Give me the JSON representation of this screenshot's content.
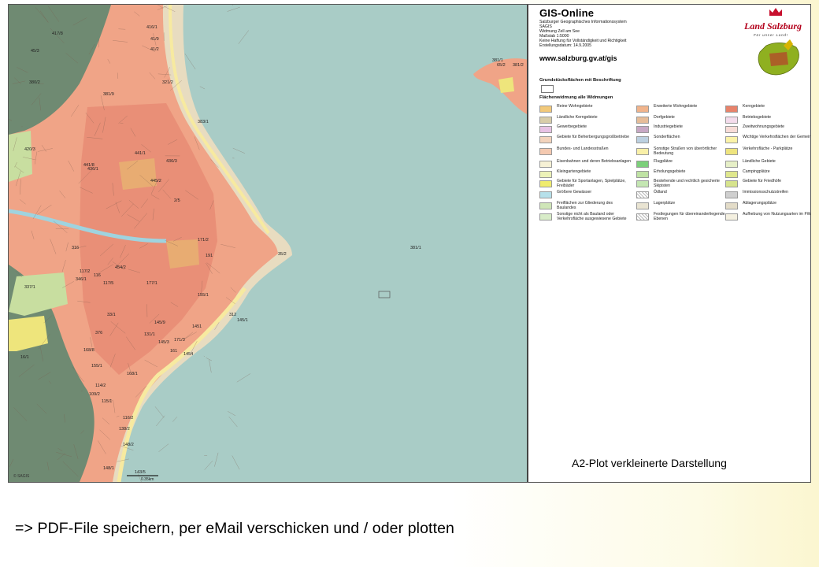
{
  "map": {
    "colors": {
      "lake": "#a9ccc6",
      "forest": "#6f8a72",
      "residential": "#f0a487",
      "core": "#e37e6a",
      "shore": "#e8dcc0",
      "green": "#c8dea0",
      "yellow": "#eee57c",
      "road": "#f7eaa0",
      "water": "#9fd3df",
      "gray": "#b9b4a7"
    },
    "parcel_labels": [
      "416/1",
      "41/9",
      "41/2",
      "417/8",
      "45/3",
      "65/2",
      "35/2",
      "381/1",
      "381/1",
      "381/2",
      "380/2",
      "321/2",
      "381/9",
      "383/1",
      "420/3",
      "436/3",
      "436/1",
      "2/5",
      "445/2",
      "441/1",
      "441/8",
      "454/2",
      "117/2",
      "337/1",
      "346/1",
      "116",
      "117/5",
      "33/1",
      "1454",
      "171/3",
      "161",
      "168/1",
      "145/9",
      "145/1",
      "376",
      "155/1",
      "114/2",
      "109/2",
      "115/1",
      "116/2",
      "138/2",
      "131/1",
      "145/3",
      "16/1",
      "148/1",
      "143/5",
      "148/2",
      "312",
      "155/1",
      "191",
      "171/2",
      "316",
      "1451",
      "168/8",
      "177/1"
    ],
    "scale_text": "0.35km",
    "copyright": "© SAGIS"
  },
  "legend": {
    "title": "GIS-Online",
    "lines": [
      "Salzburger Geographisches Informationssystem",
      "SAGIS",
      "Widmung Zell am See",
      "Maßstab 1:5000",
      "Keine Haftung für Vollständigkeit und Richtigkeit",
      "Erstellungsdatum: 14.9.2005"
    ],
    "url": "www.salzburg.gv.at/gis",
    "logo_text": "Land Salzburg",
    "logo_sub": "Für unser Land!",
    "heading_parcels": "Grundstücksflächen mit Beschriftung",
    "heading_zoning": "Flächenwidmung alle Widmungen",
    "items": [
      {
        "label": "Reine Wohngebiete",
        "color": "#f2c97a"
      },
      {
        "label": "Erweiterte Wohngebiete",
        "color": "#f1b48c"
      },
      {
        "label": "Kerngebiete",
        "color": "#e8836b"
      },
      {
        "label": "Ländliche Kerngebiete",
        "color": "#d8cda9"
      },
      {
        "label": "Dorfgebiete",
        "color": "#e6bd99"
      },
      {
        "label": "Betriebsgebiete",
        "color": "#f4dcec"
      },
      {
        "label": "Gewerbegebiete",
        "color": "#e7c2e4"
      },
      {
        "label": "Industriegebiete",
        "color": "#c7a8c4"
      },
      {
        "label": "Zweitwohnungsgebiete",
        "color": "#f7dcd7"
      },
      {
        "label": "Gebiete für Beherbergungsgroßbetriebe",
        "color": "#f3d3bc"
      },
      {
        "label": "Sonderflächen",
        "color": "#bcd0e0"
      },
      {
        "label": "Wichtige Verkehrsflächen der Gemeinde",
        "color": "#fbf3a8"
      },
      {
        "label": "Bundes- und Landesstraßen",
        "color": "#f4c9b0"
      },
      {
        "label": "Sonstige Straßen von überörtlicher Bedeutung",
        "color": "#f9f0a8"
      },
      {
        "label": "Verkehrsfläche - Parkplätze",
        "color": "#eee47e"
      },
      {
        "label": "Eisenbahnen und deren Betriebsanlagen",
        "color": "#f6f1d5"
      },
      {
        "label": "Flugplätze",
        "color": "#7ccf7a"
      },
      {
        "label": "Ländliche Gebiete",
        "color": "#e6efc7"
      },
      {
        "label": "Kleingartengebiete",
        "color": "#ecf2b8"
      },
      {
        "label": "Erholungsgebiete",
        "color": "#bfe2a4"
      },
      {
        "label": "Campingplätze",
        "color": "#dfe78e"
      },
      {
        "label": "Gebiete für Sportanlagen, Spielplätze, Freibäder",
        "color": "#f0ec6e"
      },
      {
        "label": "Bestehende und rechtlich gesicherte Skipisten",
        "color": "#c4e6b2"
      },
      {
        "label": "Gebiete für Friedhöfe",
        "color": "#d7e48d"
      },
      {
        "label": "Größere Gewässer",
        "color": "#b6e0ea"
      },
      {
        "label": "Ödland",
        "color": "#ffffff"
      },
      {
        "label": "Immissionsschutzstreifen",
        "color": "#cfcfcf"
      },
      {
        "label": "Freiflächen zur Gliederung des Baulandes",
        "color": "#cfe6b8"
      },
      {
        "label": "Lagerplätze",
        "color": "#e9e4d2"
      },
      {
        "label": "Ablagerungsplätze",
        "color": "#e3dcc8"
      },
      {
        "label": "Sonstige nicht als Bauland oder Verkehrsfläche ausgewiesene Gebiete",
        "color": "#d8ecc8"
      },
      {
        "label": "Festlegungen für übereinanderliegende Ebenen",
        "color": "#ffffff"
      },
      {
        "label": "Aufhebung von Nutzungsarten im FWP",
        "color": "#f4f0e0"
      }
    ]
  },
  "caption": "A2-Plot verkleinerte Darstellung",
  "footer": "=> PDF-File speichern, per eMail verschicken und / oder plotten"
}
